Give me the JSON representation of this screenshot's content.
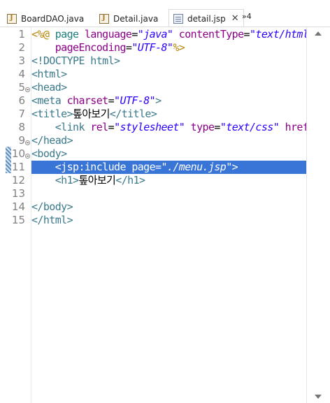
{
  "tabs": [
    {
      "label": "BoardDAO.java",
      "icon": "java-file-icon"
    },
    {
      "label": "Detail.java",
      "icon": "java-file-icon"
    },
    {
      "label": "detail.jsp",
      "icon": "jsp-file-icon",
      "active": true
    }
  ],
  "tab_close": "✕",
  "tab_overflow": "»4",
  "line_numbers": [
    "1",
    "2",
    "3",
    "4",
    "5",
    "6",
    "7",
    "8",
    "9",
    "10",
    "11",
    "12",
    "13",
    "14",
    "15"
  ],
  "code": {
    "l1": {
      "a": "<%@",
      "b": " page ",
      "c": "language",
      "d": "=",
      "e": "\"java\"",
      "f": " contentType",
      "g": "=",
      "h": "\"text/html;"
    },
    "l2": {
      "a": "    pageEncoding",
      "b": "=",
      "c": "\"UTF-8\"",
      "d": "%>"
    },
    "l3": {
      "a": "<!DOCTYPE html>"
    },
    "l4": {
      "a": "<html>"
    },
    "l5": {
      "a": "<head>"
    },
    "l6": {
      "a": "<meta",
      "b": " charset",
      "c": "=",
      "d": "\"UTF-8\"",
      "e": ">"
    },
    "l7": {
      "a": "<title>",
      "b": "톺아보기",
      "c": "</title>"
    },
    "l8": {
      "a": "    <link",
      "b": " rel",
      "c": "=",
      "d": "\"stylesheet\"",
      "e": " type",
      "f": "=",
      "g": "\"text/css\"",
      "h": " href",
      "i": "=",
      "j": "'"
    },
    "l9": {
      "a": "</head>"
    },
    "l10": {
      "a": "<body>"
    },
    "l11": {
      "a": "    <jsp:include page=",
      "b": "\"./menu.jsp\"",
      "c": ">"
    },
    "l12": {
      "a": "    <h1>",
      "b": "톺아보기",
      "c": "</h1>"
    },
    "l13": {
      "a": ""
    },
    "l14": {
      "a": "</body>"
    },
    "l15": {
      "a": "</html>"
    }
  },
  "colors": {
    "selection": "#3875d7",
    "tag": "#3a7a8c",
    "attribute": "#8c0089",
    "string": "#2a00ff",
    "directive": "#b8860b"
  }
}
